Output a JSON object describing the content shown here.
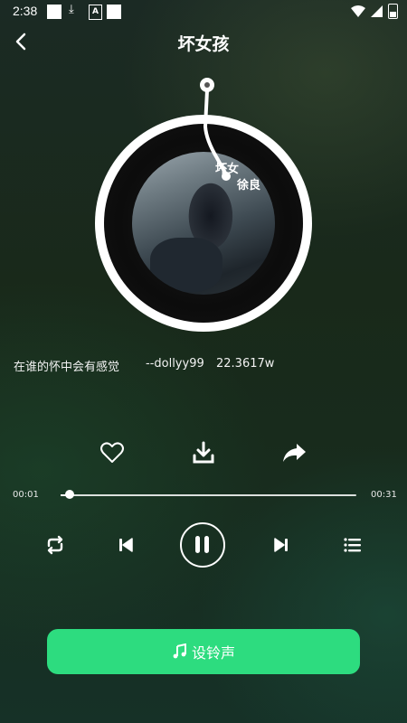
{
  "status_bar": {
    "time": "2:38"
  },
  "header": {
    "title": "坏女孩"
  },
  "disc": {
    "label_line1": "坏女",
    "label_line2": "徐良"
  },
  "song": {
    "lyric": "在谁的怀中会有感觉",
    "author": "--dollyy99",
    "plays": "22.3617w"
  },
  "progress": {
    "current": "00:01",
    "total": "00:31",
    "fraction": 0.03
  },
  "actions": {
    "ringtone_label": "设铃声"
  },
  "icons": [
    "back-icon",
    "heart-icon",
    "download-icon",
    "share-icon",
    "repeat-icon",
    "previous-icon",
    "pause-icon",
    "next-icon",
    "playlist-icon",
    "music-note-icon"
  ]
}
